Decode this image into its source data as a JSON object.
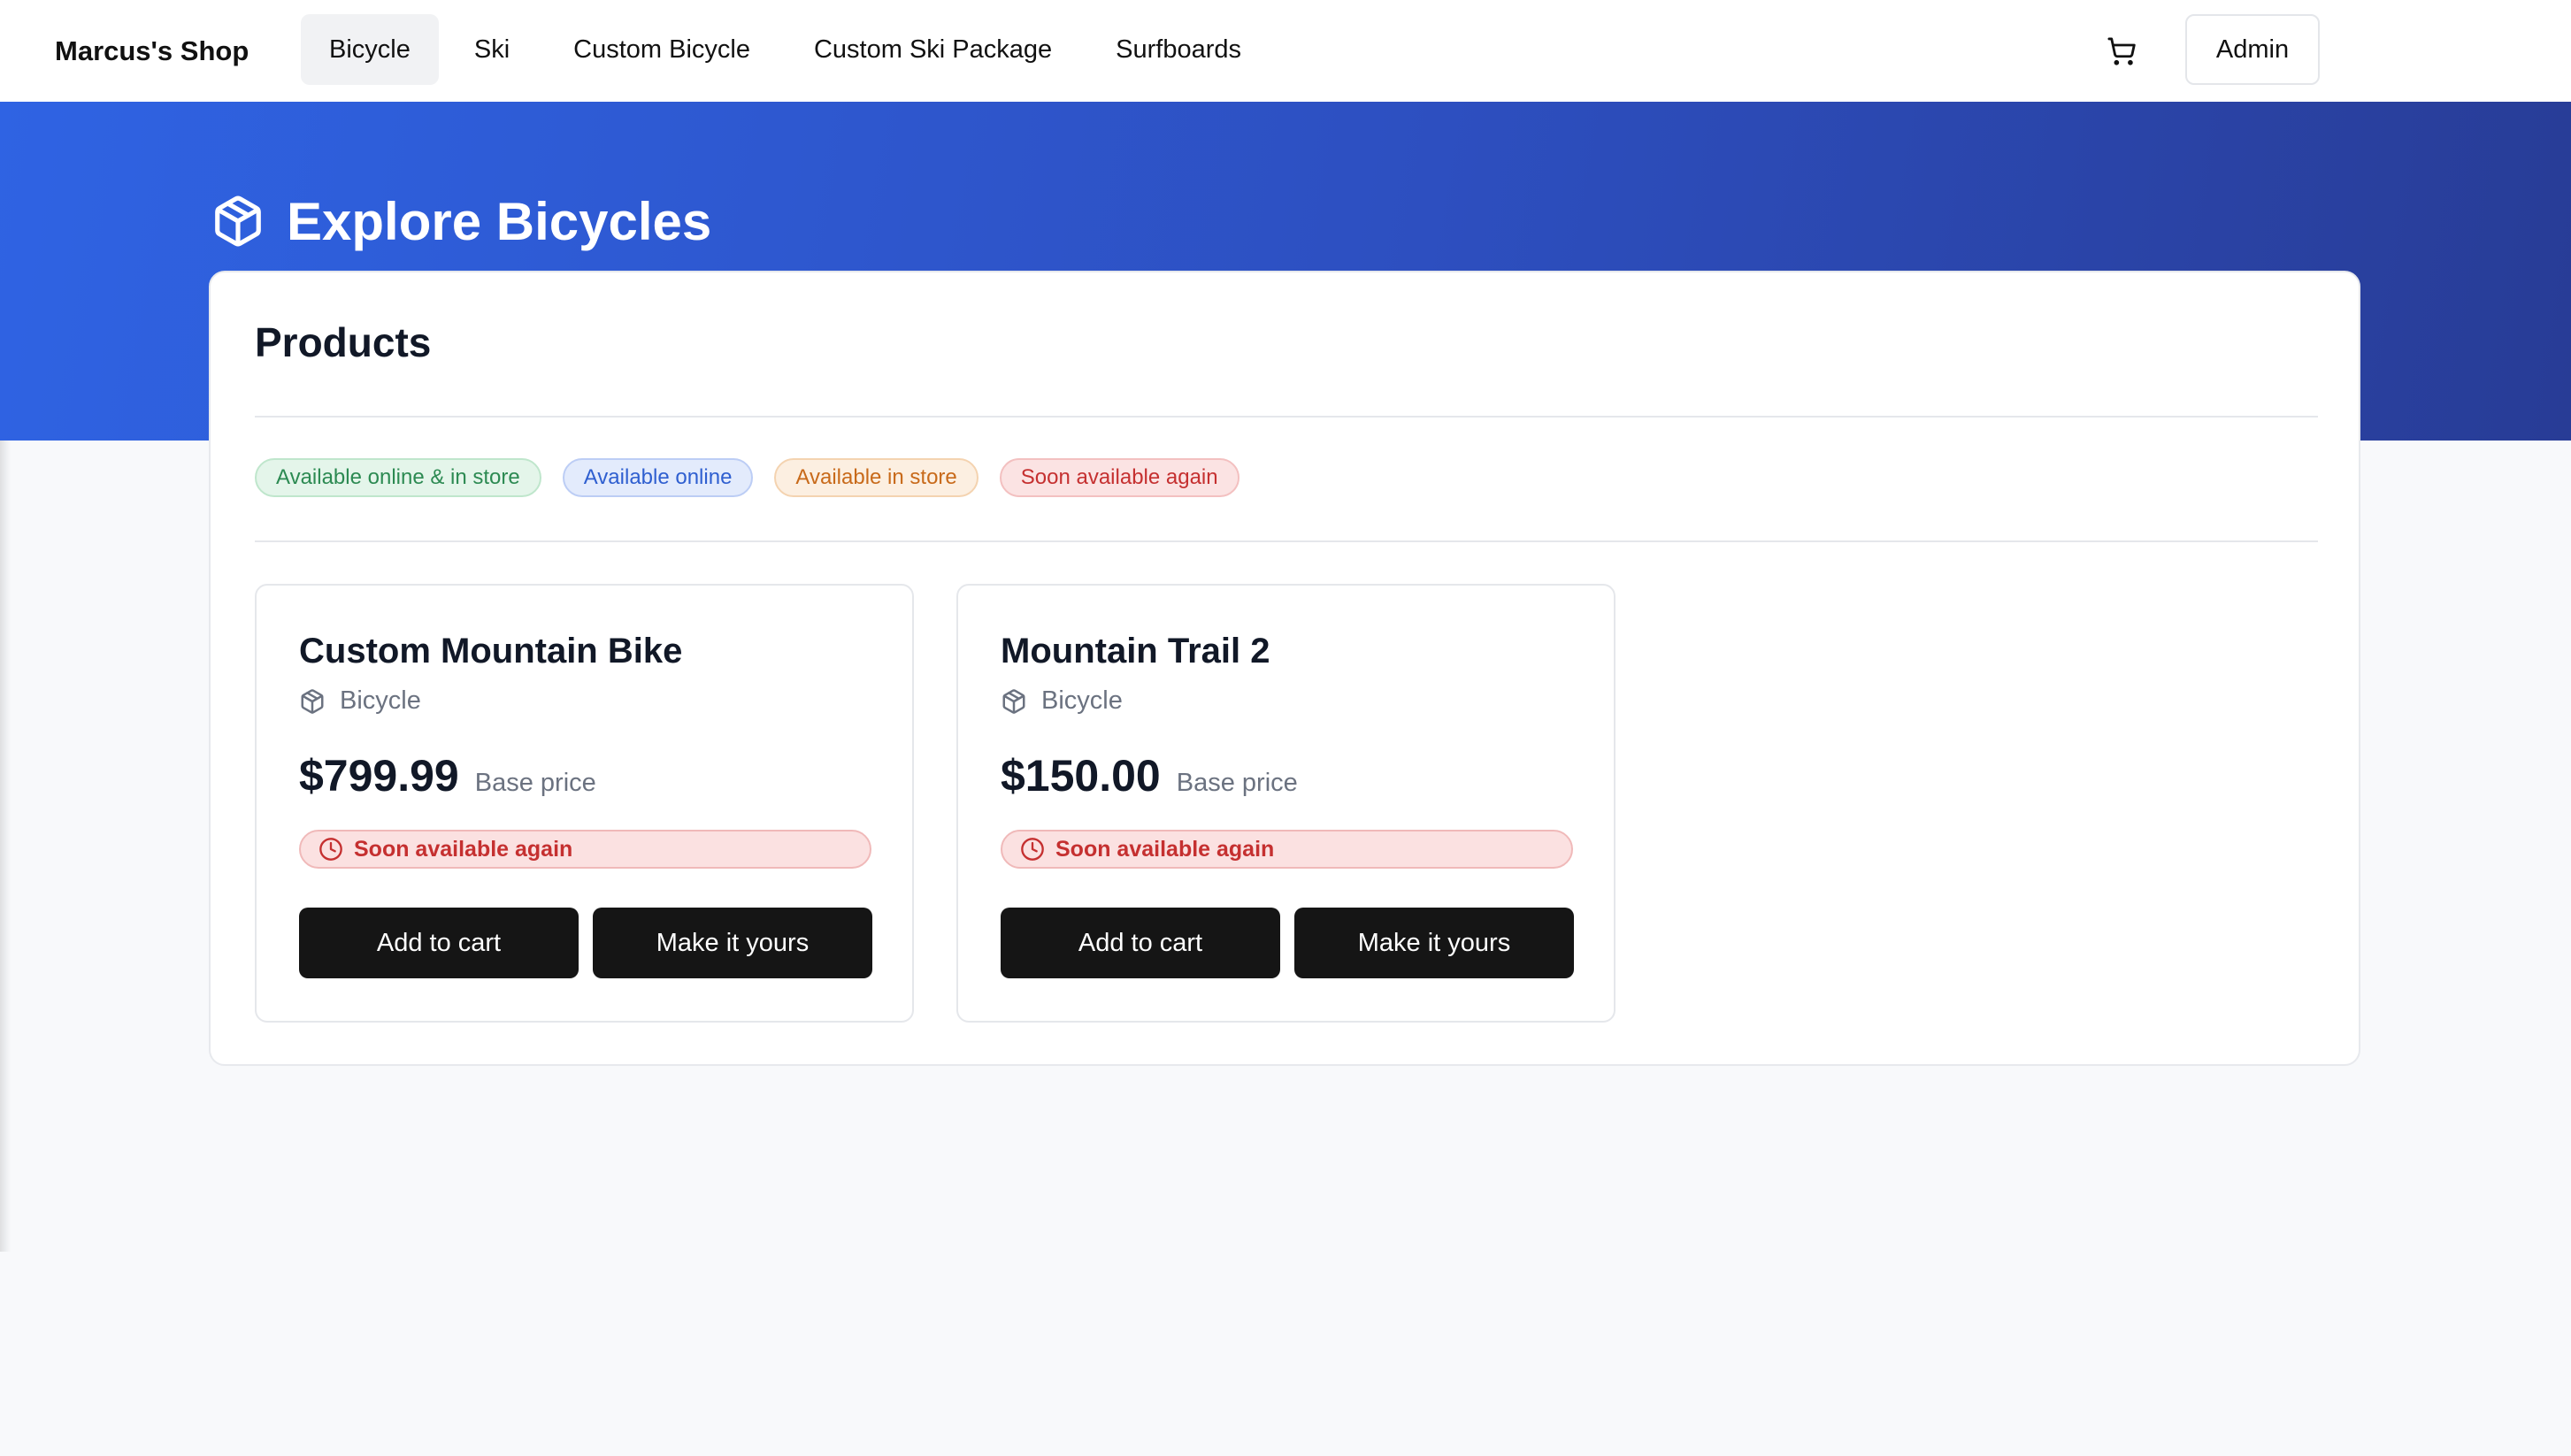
{
  "header": {
    "brand": "Marcus's Shop",
    "tabs": [
      {
        "label": "Bicycle",
        "active": true
      },
      {
        "label": "Ski",
        "active": false
      },
      {
        "label": "Custom Bicycle",
        "active": false
      },
      {
        "label": "Custom Ski Package",
        "active": false
      },
      {
        "label": "Surfboards",
        "active": false
      }
    ],
    "cart_icon": "cart-icon",
    "admin_label": "Admin"
  },
  "hero": {
    "icon": "package-icon",
    "title": "Explore Bicycles"
  },
  "panel": {
    "title": "Products",
    "badges": [
      {
        "label": "Available online & in store",
        "color": "#2c8a52"
      },
      {
        "label": "Available online",
        "color": "#2f5fd0"
      },
      {
        "label": "Available in store",
        "color": "#c86a1a"
      },
      {
        "label": "Soon available again",
        "color": "#c53030"
      }
    ],
    "products": [
      {
        "name": "Custom Mountain Bike",
        "category": "Bicycle",
        "price": "$799.99",
        "price_note": "Base price",
        "status": "Soon available again",
        "add_label": "Add to cart",
        "custom_label": "Make it yours"
      },
      {
        "name": "Mountain Trail 2",
        "category": "Bicycle",
        "price": "$150.00",
        "price_note": "Base price",
        "status": "Soon available again",
        "add_label": "Add to cart",
        "custom_label": "Make it yours"
      }
    ]
  },
  "colors": {
    "hero_start": "#2f63e3",
    "hero_end": "#283c96",
    "button_dark": "#151515",
    "status_red": "#c53030"
  }
}
